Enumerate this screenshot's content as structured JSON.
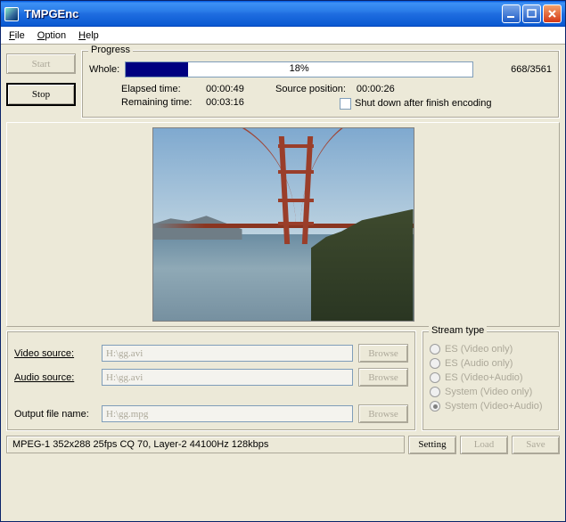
{
  "window": {
    "title": "TMPGEnc"
  },
  "menu": {
    "file": "File",
    "option": "Option",
    "help": "Help"
  },
  "buttons": {
    "start": "Start",
    "stop": "Stop"
  },
  "progress": {
    "legend": "Progress",
    "whole_label": "Whole:",
    "percent": "18%",
    "count": "668/3561",
    "elapsed_label": "Elapsed time:",
    "elapsed": "00:00:49",
    "remaining_label": "Remaining time:",
    "remaining": "00:03:16",
    "srcpos_label": "Source position:",
    "srcpos": "00:00:26",
    "shutdown_label": "Shut down after finish encoding"
  },
  "sources": {
    "video_label": "Video source:",
    "video_value": "H:\\gg.avi",
    "audio_label": "Audio source:",
    "audio_value": "H:\\gg.avi",
    "output_label": "Output file name:",
    "output_value": "H:\\gg.mpg",
    "browse": "Browse"
  },
  "stream": {
    "legend": "Stream type",
    "opt1": "ES (Video only)",
    "opt2": "ES (Audio only)",
    "opt3": "ES (Video+Audio)",
    "opt4": "System (Video only)",
    "opt5": "System (Video+Audio)"
  },
  "status": {
    "text": "MPEG-1 352x288 25fps CQ 70,  Layer-2 44100Hz 128kbps",
    "setting": "Setting",
    "load": "Load",
    "save": "Save"
  }
}
